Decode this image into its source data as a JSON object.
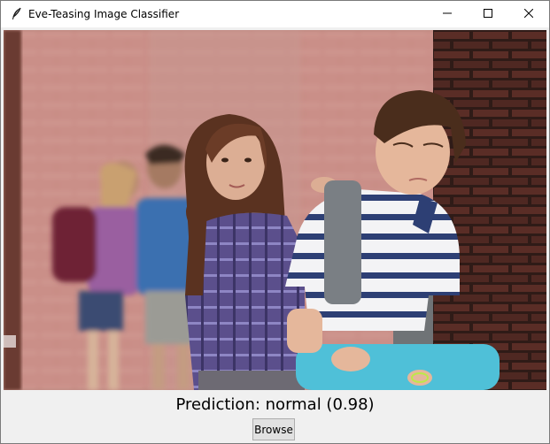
{
  "window": {
    "title": "Eve-Teasing Image Classifier",
    "controls": [
      "minimize-icon",
      "maximize-icon",
      "close-icon"
    ]
  },
  "image": {
    "description_icon": "photo"
  },
  "prediction": {
    "text": "Prediction: normal (0.98)"
  },
  "actions": {
    "browse_label": "Browse"
  },
  "colors": {
    "titlebar": "#ffffff",
    "window_bg": "#f0f0f0",
    "button_bg": "#e1e1e1",
    "button_border": "#adadad"
  }
}
